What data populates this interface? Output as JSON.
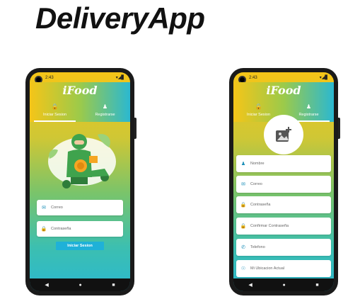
{
  "app_title": "DeliveryApp",
  "status": {
    "time": "2:43",
    "icons": "▾◢▊"
  },
  "brand": "iFood",
  "tabs": {
    "login": "Iniciar Sesion",
    "register": "Registrarse"
  },
  "login": {
    "email_placeholder": "Correo",
    "password_placeholder": "Contraseña",
    "submit_label": "Iniciar Sesion"
  },
  "register": {
    "fields": {
      "name": "Nombre",
      "email": "Correo",
      "password": "Contraseña",
      "confirm_password": "Confirmar Contraseña",
      "phone": "Telefono",
      "location": "Mi Ubicacion Actual"
    }
  },
  "nav": {
    "back": "◀",
    "home": "●",
    "recent": "■"
  },
  "colors": {
    "accent": "#1fb1d8",
    "yellow": "#f5c518",
    "teal": "#2bb8d0"
  }
}
